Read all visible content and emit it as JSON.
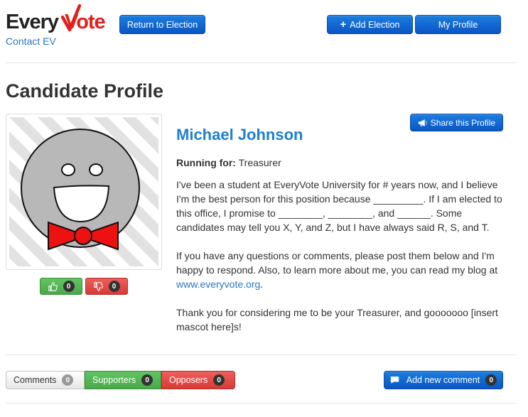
{
  "header": {
    "logo_every": "Every",
    "logo_vote": "Vote",
    "contact_link": "Contact EV",
    "return_button": "Return to Election",
    "add_election_button": "Add Election",
    "add_election_icon": "+",
    "my_profile_button": "My Profile"
  },
  "page": {
    "title": "Candidate Profile"
  },
  "candidate": {
    "name": "Michael Johnson",
    "running_for_label": "Running for:",
    "running_for_value": "Treasurer",
    "paragraph1": "I've been a student at EveryVote University for # years now, and I believe I'm the best person for this position because _________. If I am elected to this office, I promise to ________, ________, and ______. Some candidates may tell you X, Y, and Z, but I have always said R, S, and T.",
    "paragraph2_text": "If you have any questions or comments, please post them below and I'm happy to respond. Also, to learn more about me, you can read my blog at ",
    "paragraph2_link": "www.everyvote.org",
    "paragraph2_end": ".",
    "paragraph3": "Thank you for considering me to be your Treasurer, and gooooooo [insert mascot here]s!"
  },
  "votes": {
    "up_count": "0",
    "down_count": "0"
  },
  "share": {
    "label": "Share this Profile"
  },
  "tabs": {
    "comments_label": "Comments",
    "comments_count": "0",
    "supporters_label": "Supporters",
    "supporters_count": "0",
    "opposers_label": "Opposers",
    "opposers_count": "0"
  },
  "comments": {
    "add_label": "Add new comment",
    "count": "0"
  },
  "colors": {
    "brand_red": "#e0201c",
    "brand_dark": "#222222",
    "primary_blue": "#0b6bd3",
    "success_green": "#51b351",
    "danger_red": "#e04743",
    "name_blue": "#1e7fcf"
  },
  "icons": {
    "thumb_up": "thumbs-up-icon",
    "thumb_down": "thumbs-down-icon",
    "share": "megaphone-icon",
    "comment": "comment-icon"
  }
}
